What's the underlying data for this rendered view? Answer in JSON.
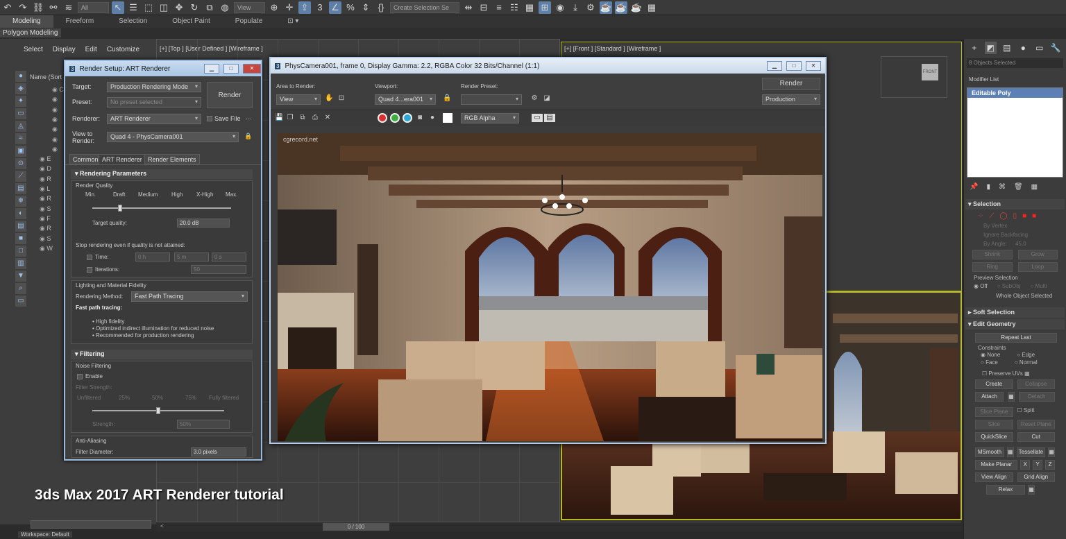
{
  "toolbar": {
    "filter_value": "All",
    "view_value": "View",
    "selection_set_placeholder": "Create Selection Se"
  },
  "ribbon": {
    "tabs": [
      "Modeling",
      "Freeform",
      "Selection",
      "Object Paint",
      "Populate"
    ],
    "sub_label": "Polygon Modeling"
  },
  "scene_explorer": {
    "menu": [
      "Select",
      "Display",
      "Edit",
      "Customize"
    ],
    "header": "Name (Sort",
    "row_labels": [
      "C",
      "",
      "",
      "",
      "",
      "",
      "",
      "E",
      "D",
      "R",
      "L",
      "R",
      "S",
      "F",
      "R",
      "S",
      "W"
    ]
  },
  "viewports": {
    "top_label": "[+] [Top ] [User Defined ] [Wireframe ]",
    "front_label": "[+] [Front ] [Standard ] [Wireframe ]",
    "front_overlay": "FRONT"
  },
  "render_setup": {
    "title": "Render Setup: ART Renderer",
    "target_label": "Target:",
    "target_value": "Production Rendering Mode",
    "preset_label": "Preset:",
    "preset_value": "No preset selected",
    "renderer_label": "Renderer:",
    "renderer_value": "ART Renderer",
    "save_file_label": "Save File",
    "view_to_render_label": "View to Render:",
    "view_to_render_value": "Quad 4 - PhysCamera001",
    "render_button": "Render",
    "tabs": [
      "Common",
      "ART Renderer",
      "Render Elements"
    ],
    "rendering_parameters": "Rendering Parameters",
    "render_quality": "Render Quality",
    "quality_levels": [
      "Min.",
      "Draft",
      "Medium",
      "High",
      "X-High",
      "Max."
    ],
    "target_quality_label": "Target quality:",
    "target_quality_value": "20.0 dB",
    "stop_rendering_text": "Stop rendering even if quality is not attained:",
    "time_label": "Time:",
    "time_h": "0 h",
    "time_m": "5 m",
    "time_s": "0 s",
    "iterations_label": "Iterations:",
    "iterations_value": "50",
    "lighting_fidelity": "Lighting and Material Fidelity",
    "rendering_method_label": "Rendering Method:",
    "rendering_method_value": "Fast Path Tracing",
    "fast_path_heading": "Fast path tracing:",
    "fast_path_bullets": [
      "• High fidelity",
      "• Optimized indirect illumination for reduced noise",
      "• Recommended for production rendering"
    ],
    "filtering": "Filtering",
    "noise_filtering": "Noise Filtering",
    "enable_label": "Enable",
    "filter_strength_label": "Filter Strength:",
    "filter_levels": [
      "Unfiltered",
      "25%",
      "50%",
      "75%",
      "Fully filtered"
    ],
    "strength_label": "Strength:",
    "strength_value": "50%",
    "anti_aliasing": "Anti-Aliasing",
    "filter_diameter_label": "Filter Diameter:",
    "filter_diameter_value": "3.0 pixels",
    "quality_slider_fraction": 0.2,
    "strength_slider_fraction": 0.5
  },
  "frame_buffer": {
    "title": "PhysCamera001, frame 0, Display Gamma: 2.2, RGBA Color 32 Bits/Channel (1:1)",
    "area_label": "Area to Render:",
    "area_value": "View",
    "viewport_label": "Viewport:",
    "viewport_value": "Quad 4...era001",
    "preset_label": "Render Preset:",
    "render_button": "Render",
    "production_value": "Production",
    "channel_value": "RGB Alpha",
    "watermark": "cgrecord.net"
  },
  "command_panel": {
    "objects_selected": "8 Objects Selected",
    "modifier_list": "Modifier List",
    "stack_item": "Editable Poly",
    "selection_title": "Selection",
    "by_vertex": "By Vertex",
    "ignore_backfacing": "Ignore Backfacing",
    "by_angle": "By Angle:",
    "by_angle_value": "45.0",
    "shrink": "Shrink",
    "grow": "Grow",
    "ring": "Ring",
    "loop": "Loop",
    "preview_selection": "Preview Selection",
    "preview_off": "Off",
    "preview_subobj": "SubObj",
    "preview_multi": "Multi",
    "whole_object": "Whole Object Selected",
    "soft_selection": "Soft Selection",
    "edit_geometry": "Edit Geometry",
    "repeat_last": "Repeat Last",
    "constraints": "Constraints",
    "c_none": "None",
    "c_edge": "Edge",
    "c_face": "Face",
    "c_normal": "Normal",
    "preserve_uvs": "Preserve UVs",
    "create": "Create",
    "collapse": "Collapse",
    "attach": "Attach",
    "detach": "Detach",
    "slice_plane": "Slice Plane",
    "split": "Split",
    "slice": "Slice",
    "reset_plane": "Reset Plane",
    "quickslice": "QuickSlice",
    "cut": "Cut",
    "msmooth": "MSmooth",
    "tessellate": "Tessellate",
    "make_planar": "Make Planar",
    "x": "X",
    "y": "Y",
    "z": "Z",
    "view_align": "View Align",
    "grid_align": "Grid Align",
    "relax": "Relax"
  },
  "bottom": {
    "caption": "3ds Max 2017 ART Renderer tutorial",
    "time_value": "0 / 100",
    "workspace": "Workspace: Default"
  },
  "colors": {
    "accent_blue": "#5c7fb5",
    "viewport_highlight": "#b8b82c",
    "dialog_border": "#9bb9dc"
  }
}
